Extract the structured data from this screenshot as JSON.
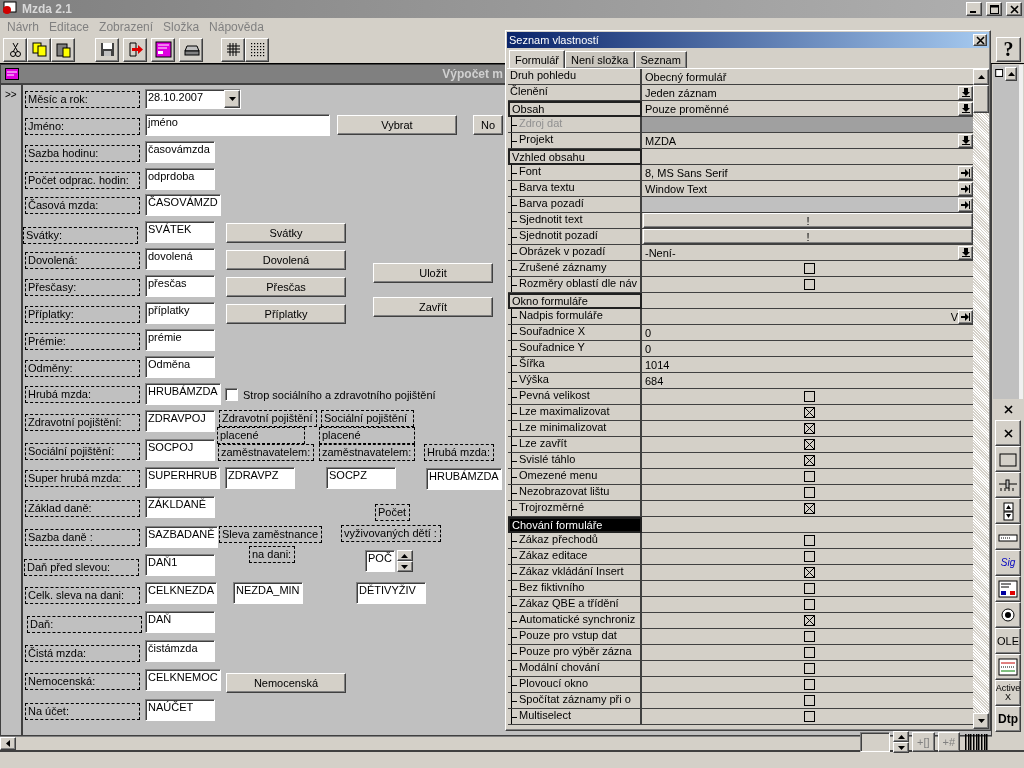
{
  "window": {
    "title": "Mzda 2.1"
  },
  "menu": [
    "Návrh",
    "Editace",
    "Zobrazení",
    "Složka",
    "Nápověda"
  ],
  "help_button": "?",
  "form_window": {
    "title": "Výpočet m",
    "gutter": ">>"
  },
  "form_controls": [
    {
      "kind": "label",
      "text": "Měsíc a rok:"
    },
    {
      "kind": "label",
      "text": "Jméno:"
    },
    {
      "kind": "label",
      "text": "Sazba hodinu:"
    },
    {
      "kind": "label",
      "text": "Počet odprac. hodin:"
    },
    {
      "kind": "label",
      "text": "Časová mzda:"
    },
    {
      "kind": "label",
      "text": "Svátky:"
    },
    {
      "kind": "label",
      "text": "Dovolená:"
    },
    {
      "kind": "label",
      "text": "Přesčasy:"
    },
    {
      "kind": "label",
      "text": "Příplatky:"
    },
    {
      "kind": "label",
      "text": "Prémie:"
    },
    {
      "kind": "label",
      "text": "Odměny:"
    },
    {
      "kind": "label",
      "text": "Hrubá mzda:"
    },
    {
      "kind": "label",
      "text": "Zdravotní pojištění:"
    },
    {
      "kind": "label",
      "text": "Sociální pojištění:"
    },
    {
      "kind": "label",
      "text": "Super hrubá mzda:"
    },
    {
      "kind": "label",
      "text": "Základ daně:"
    },
    {
      "kind": "label",
      "text": "Sazba daně :"
    },
    {
      "kind": "label",
      "text": "Daň před slevou:"
    },
    {
      "kind": "label",
      "text": "Celk. sleva na dani:"
    },
    {
      "kind": "label",
      "text": "Daň:"
    },
    {
      "kind": "label",
      "text": "Čistá mzda:"
    },
    {
      "kind": "label",
      "text": "Nemocenská:"
    },
    {
      "kind": "label",
      "text": "Na účet:"
    },
    {
      "kind": "combo",
      "text": "28.10.2007"
    },
    {
      "kind": "field",
      "text": "jméno"
    },
    {
      "kind": "field",
      "text": "časovámzda"
    },
    {
      "kind": "field",
      "text": "odprdoba"
    },
    {
      "kind": "field",
      "text": "ČASOVÁMZD"
    },
    {
      "kind": "field",
      "text": "SVÁTEK"
    },
    {
      "kind": "field",
      "text": "dovolená"
    },
    {
      "kind": "field",
      "text": "přesčas"
    },
    {
      "kind": "field",
      "text": "příplatky"
    },
    {
      "kind": "field",
      "text": "prémie"
    },
    {
      "kind": "field",
      "text": "Odměna"
    },
    {
      "kind": "field",
      "text": "HRUBÁMZDA"
    },
    {
      "kind": "field",
      "text": "ZDRAVPOJ"
    },
    {
      "kind": "field",
      "text": "SOCPOJ"
    },
    {
      "kind": "field",
      "text": "SUPERHRUB"
    },
    {
      "kind": "field",
      "text": "ZÁKLDANĚ"
    },
    {
      "kind": "field",
      "text": "SAZBADANĚ"
    },
    {
      "kind": "field",
      "text": "DAŇ1"
    },
    {
      "kind": "field",
      "text": "CELKNEZDA"
    },
    {
      "kind": "field",
      "text": "DAŇ"
    },
    {
      "kind": "field",
      "text": "čistámzda"
    },
    {
      "kind": "field",
      "text": "CELKNEMOC"
    },
    {
      "kind": "field",
      "text": "NAÚČET"
    },
    {
      "kind": "button",
      "text": "Vybrat"
    },
    {
      "kind": "button",
      "text": "No"
    },
    {
      "kind": "button",
      "text": "Svátky"
    },
    {
      "kind": "button",
      "text": "Dovolená"
    },
    {
      "kind": "button",
      "text": "Přesčas"
    },
    {
      "kind": "button",
      "text": "Příplatky"
    },
    {
      "kind": "button",
      "text": "Uložit"
    },
    {
      "kind": "button",
      "text": "Zavřít"
    },
    {
      "kind": "checkbox",
      "text": "Strop sociálního a zdravotního pojištění",
      "checked": false
    },
    {
      "kind": "label",
      "text": "Zdravotní pojištění"
    },
    {
      "kind": "label",
      "text": "placené"
    },
    {
      "kind": "label",
      "text": "zaměstnavatelem:"
    },
    {
      "kind": "label",
      "text": "Sociální pojištění"
    },
    {
      "kind": "label",
      "text": "placené"
    },
    {
      "kind": "label",
      "text": "zaměstnavatelem:"
    },
    {
      "kind": "label",
      "text": "Hrubá mzda:"
    },
    {
      "kind": "field",
      "text": "ZDRAVPZ"
    },
    {
      "kind": "field",
      "text": "SOCPZ"
    },
    {
      "kind": "field",
      "text": "HRUBÁMZDA"
    },
    {
      "kind": "label",
      "text": "Počet"
    },
    {
      "kind": "label",
      "text": "Sleva zaměstnance"
    },
    {
      "kind": "label",
      "text": "vyživovaných dětí :"
    },
    {
      "kind": "label",
      "text": "na dani:"
    },
    {
      "kind": "spinner",
      "text": "POČ"
    },
    {
      "kind": "field",
      "text": "NEZDA_MIN"
    },
    {
      "kind": "field",
      "text": "DĚTIVYŽIV"
    },
    {
      "kind": "button",
      "text": "Nemocenská"
    }
  ],
  "property_panel": {
    "title": "Seznam vlastností",
    "tabs": [
      {
        "label": "Formulář",
        "selected": true
      },
      {
        "label": "Není složka",
        "selected": false
      },
      {
        "label": "Seznam",
        "selected": false
      }
    ],
    "rows": [
      {
        "label": "Druh pohledu",
        "kind": "text",
        "value": "Obecný formulář",
        "selected": false
      },
      {
        "label": "Členění",
        "kind": "dropdown",
        "value": "Jeden záznam",
        "selected": false
      },
      {
        "label": "Obsah",
        "kind": "dropdown",
        "value": "Pouze proměnné",
        "selected": false,
        "children": [
          {
            "label": "Zdroj dat",
            "kind": "text",
            "disabled": true,
            "selected": false
          },
          {
            "label": "Projekt",
            "kind": "dropdown",
            "value": "MZDA",
            "disabled": false,
            "selected": false
          }
        ]
      },
      {
        "label": "Vzhled obsahu",
        "kind": "text",
        "selected": false,
        "children": [
          {
            "label": "Font",
            "kind": "picker",
            "value": "8, MS Sans Serif",
            "selected": false
          },
          {
            "label": "Barva textu",
            "kind": "picker",
            "value": "Window Text",
            "selected": false
          },
          {
            "label": "Barva pozadí",
            "kind": "picker",
            "color": "#c0c0c0",
            "selected": false
          },
          {
            "label": "Sjednotit text",
            "kind": "action",
            "value": "!",
            "selected": false
          },
          {
            "label": "Sjednotit pozadí",
            "kind": "action",
            "value": "!",
            "selected": false
          },
          {
            "label": "Obrázek v pozadí",
            "kind": "dropdown",
            "value": "-Není-",
            "selected": false
          },
          {
            "label": "Zrušené záznamy",
            "kind": "checkbox",
            "checked": false,
            "selected": false
          },
          {
            "label": "Rozměry oblastí dle náv",
            "kind": "checkbox",
            "checked": false,
            "selected": false
          }
        ]
      },
      {
        "label": "Okno formuláře",
        "kind": "text",
        "selected": false,
        "children": [
          {
            "label": "Nadpis formuláře",
            "kind": "caption",
            "value": "V",
            "selected": false
          },
          {
            "label": "Souřadnice X",
            "kind": "text",
            "value": "0",
            "selected": false
          },
          {
            "label": "Souřadnice Y",
            "kind": "text",
            "value": "0",
            "selected": false
          },
          {
            "label": "Šířka",
            "kind": "text",
            "value": "1014",
            "selected": false
          },
          {
            "label": "Výška",
            "kind": "text",
            "value": "684",
            "selected": false
          },
          {
            "label": "Pevná velikost",
            "kind": "checkbox",
            "checked": false,
            "selected": false
          },
          {
            "label": "Lze maximalizovat",
            "kind": "checkbox",
            "checked": true,
            "selected": false
          },
          {
            "label": "Lze minimalizovat",
            "kind": "checkbox",
            "checked": true,
            "selected": false
          },
          {
            "label": "Lze zavřít",
            "kind": "checkbox",
            "checked": true,
            "selected": false
          },
          {
            "label": "Svislé táhlo",
            "kind": "checkbox",
            "checked": true,
            "selected": false
          },
          {
            "label": "Omezené menu",
            "kind": "checkbox",
            "checked": false,
            "selected": false
          },
          {
            "label": "Nezobrazovat lištu",
            "kind": "checkbox",
            "checked": false,
            "selected": false
          },
          {
            "label": "Trojrozměrné",
            "kind": "checkbox",
            "checked": true,
            "selected": false
          }
        ]
      },
      {
        "label": "Chování formuláře",
        "kind": "text",
        "selected": true,
        "children": [
          {
            "label": "Zákaz přechodů",
            "kind": "checkbox",
            "checked": false,
            "selected": false
          },
          {
            "label": "Zákaz editace",
            "kind": "checkbox",
            "checked": false,
            "selected": false
          },
          {
            "label": "Zákaz vkládání Insert",
            "kind": "checkbox",
            "checked": true,
            "selected": false
          },
          {
            "label": "Bez fiktivního",
            "kind": "checkbox",
            "checked": false,
            "selected": false
          },
          {
            "label": "Zákaz QBE a třídění",
            "kind": "checkbox",
            "checked": false,
            "selected": false
          },
          {
            "label": "Automatické synchroniz",
            "kind": "checkbox",
            "checked": true,
            "selected": false
          },
          {
            "label": "Pouze pro vstup dat",
            "kind": "checkbox",
            "checked": false,
            "selected": false
          },
          {
            "label": "Pouze pro výběr zázna",
            "kind": "checkbox",
            "checked": false,
            "selected": false
          },
          {
            "label": "Modální chování",
            "kind": "checkbox",
            "checked": false,
            "selected": false
          },
          {
            "label": "Plovoucí okno",
            "kind": "checkbox",
            "checked": false,
            "selected": false
          },
          {
            "label": "Spočítat záznamy při o",
            "kind": "checkbox",
            "checked": false,
            "selected": false
          },
          {
            "label": "Multiselect",
            "kind": "checkbox",
            "checked": false,
            "selected": false
          }
        ]
      }
    ]
  },
  "palette_labels": [
    "Sig",
    "OLE",
    "Active X",
    "Dtp"
  ],
  "bottom_tools": [
    "+[]",
    "+#"
  ]
}
